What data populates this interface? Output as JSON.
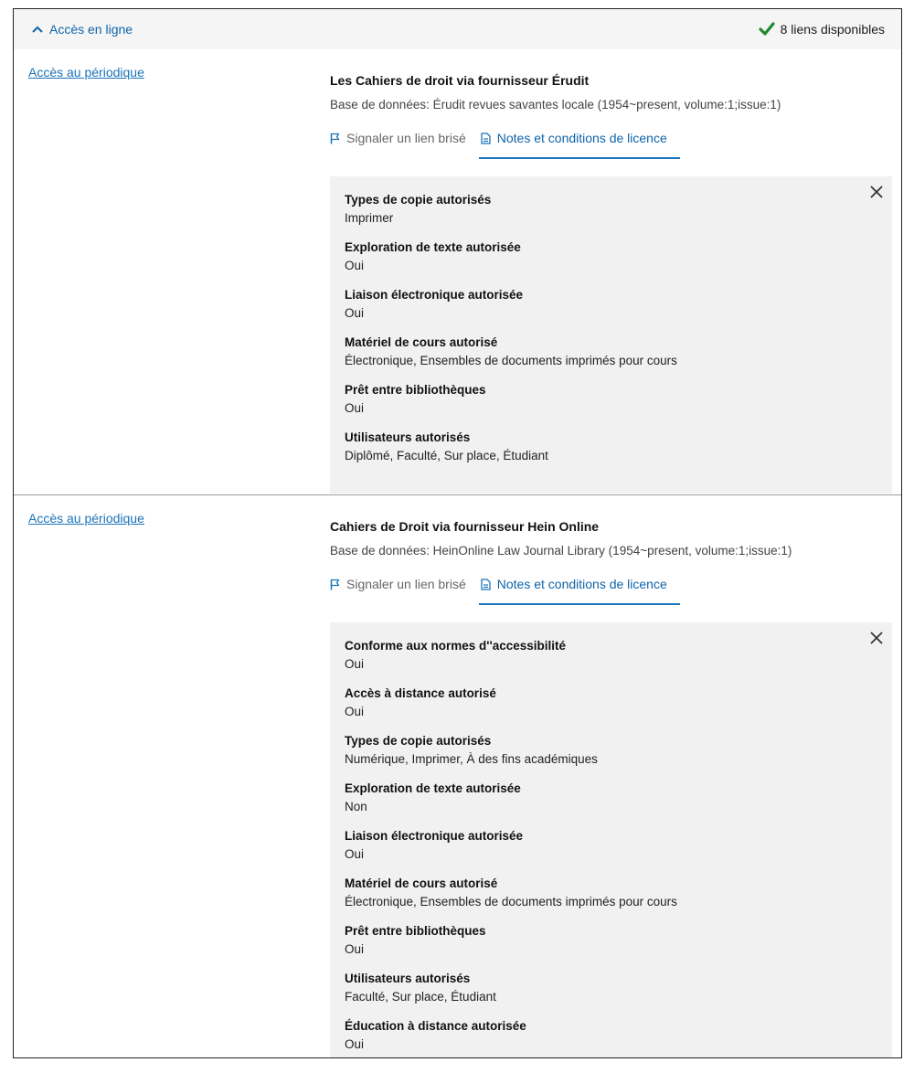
{
  "header": {
    "toggle_label": "Accès en ligne",
    "available_label": "8 liens disponibles"
  },
  "colors": {
    "link": "#1a73b8",
    "check": "#1e8a2e",
    "panel_bg": "#f1f1f1"
  },
  "links": [
    {
      "access_label": "Accès au périodique",
      "title": "Les Cahiers de droit via fournisseur Érudit",
      "database": "Base de données: Érudit revues savantes locale (1954~present, volume:1;issue:1)",
      "report_label": "Signaler un lien brisé",
      "notes_label": "Notes et conditions de licence",
      "terms": [
        {
          "label": "Types de copie autorisés",
          "value": "Imprimer"
        },
        {
          "label": "Exploration de texte autorisée",
          "value": "Oui"
        },
        {
          "label": "Liaison électronique autorisée",
          "value": "Oui"
        },
        {
          "label": "Matériel de cours autorisé",
          "value": "Électronique, Ensembles de documents imprimés pour cours"
        },
        {
          "label": "Prêt entre bibliothèques",
          "value": "Oui"
        },
        {
          "label": "Utilisateurs autorisés",
          "value": "Diplômé, Faculté, Sur place, Étudiant"
        }
      ]
    },
    {
      "access_label": "Accès au périodique",
      "title": "Cahiers de Droit via fournisseur Hein Online",
      "database": "Base de données: HeinOnline Law Journal Library (1954~present, volume:1;issue:1)",
      "report_label": "Signaler un lien brisé",
      "notes_label": "Notes et conditions de licence",
      "terms": [
        {
          "label": "Conforme aux normes d''accessibilité",
          "value": "Oui"
        },
        {
          "label": "Accès à distance autorisé",
          "value": "Oui"
        },
        {
          "label": "Types de copie autorisés",
          "value": "Numérique, Imprimer, À des fins académiques"
        },
        {
          "label": "Exploration de texte autorisée",
          "value": "Non"
        },
        {
          "label": "Liaison électronique autorisée",
          "value": "Oui"
        },
        {
          "label": "Matériel de cours autorisé",
          "value": "Électronique, Ensembles de documents imprimés pour cours"
        },
        {
          "label": "Prêt entre bibliothèques",
          "value": "Oui"
        },
        {
          "label": "Utilisateurs autorisés",
          "value": "Faculté, Sur place, Étudiant"
        },
        {
          "label": "Éducation à distance autorisée",
          "value": "Oui"
        }
      ]
    }
  ]
}
